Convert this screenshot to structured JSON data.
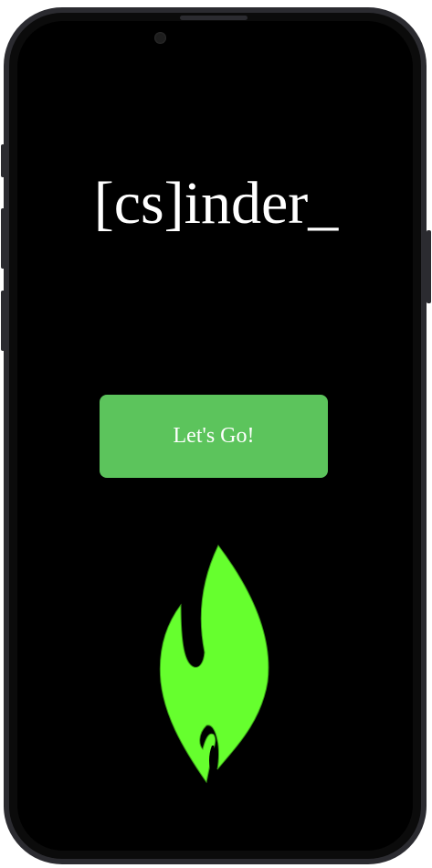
{
  "app": {
    "title": "[cs]inder_"
  },
  "actions": {
    "start_label": "Let's Go!"
  },
  "icons": {
    "logo": "flame-icon"
  },
  "colors": {
    "screen_background": "#000000",
    "title_text": "#ffffff",
    "button_background": "#5cc45c",
    "button_text": "#ffffff",
    "logo_fill": "#66ff2e",
    "phone_frame": "#2b2b30"
  }
}
